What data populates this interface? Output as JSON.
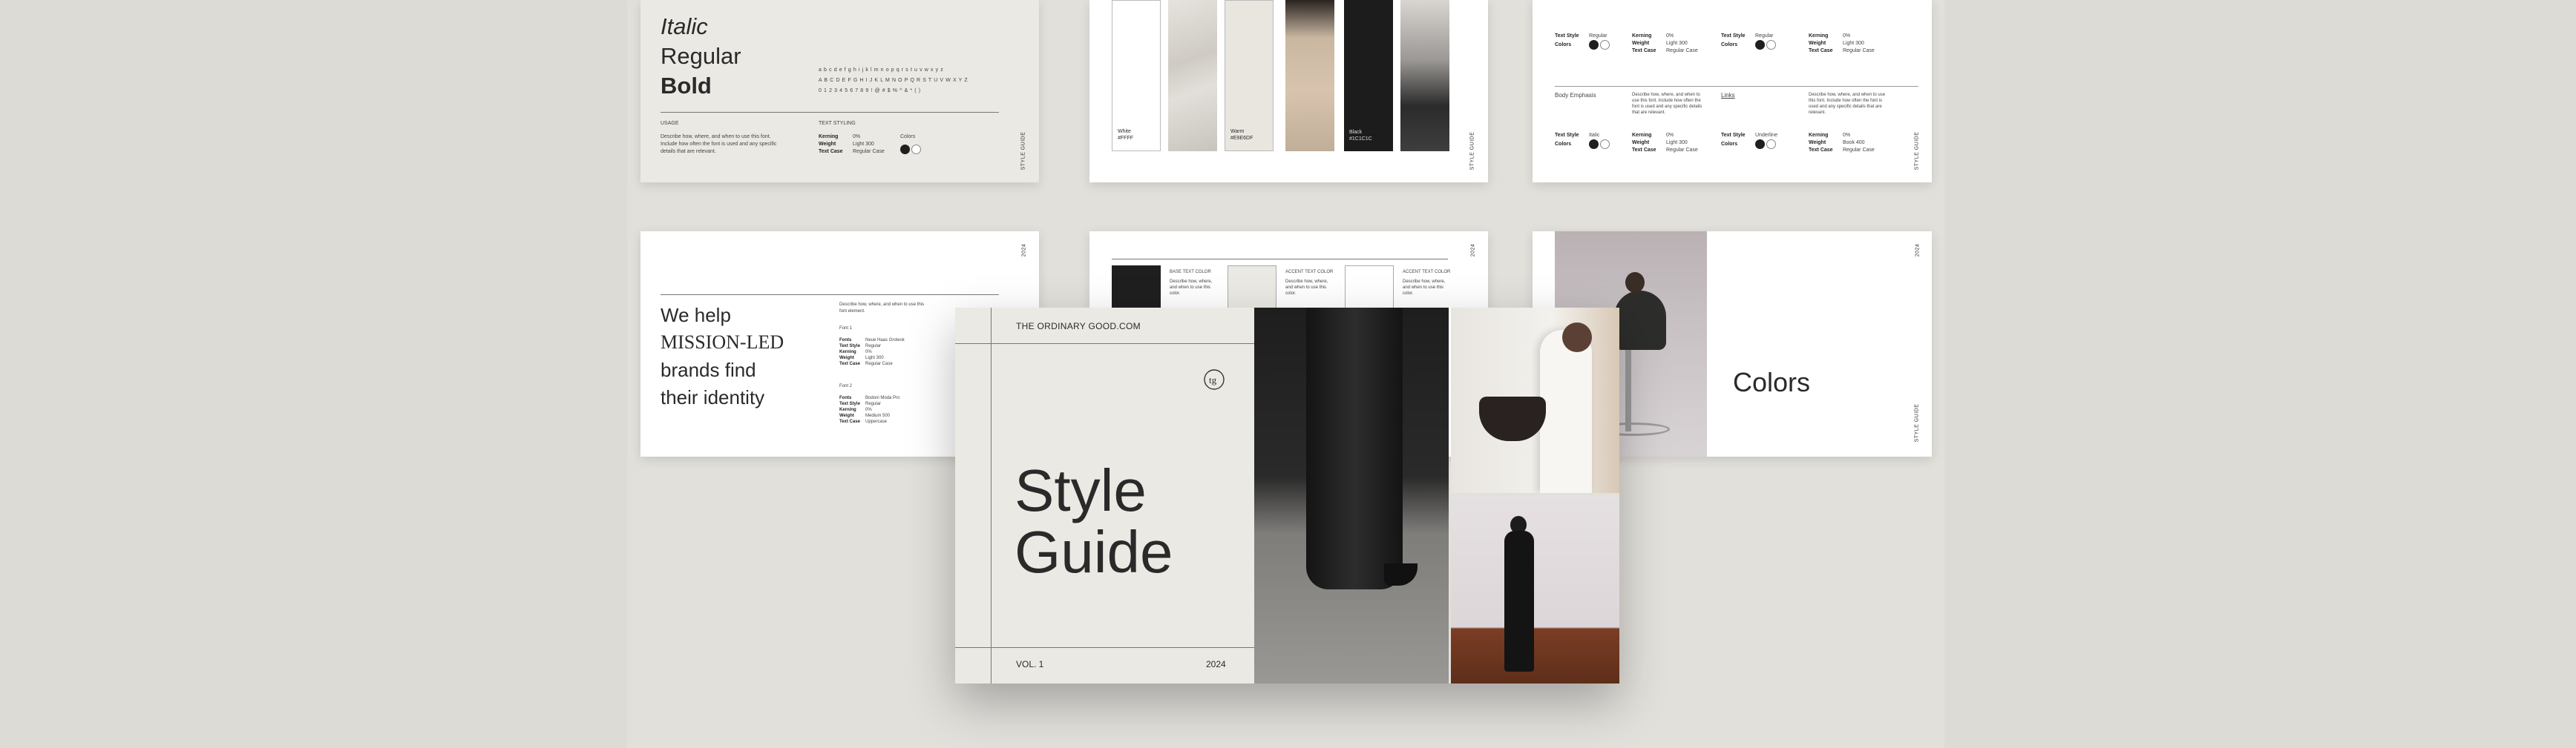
{
  "brand": "THE ORDINARY GOOD.COM",
  "cover": {
    "title_line1": "Style",
    "title_line2": "Guide",
    "vol": "VOL. 1",
    "year": "2024"
  },
  "side_label": "STYLE GUIDE",
  "corner_num": "2024",
  "typo_slide": {
    "italic": "Italic",
    "regular": "Regular",
    "bold": "Bold",
    "lower": "a b c d e f g h i j k l m n o p q r s t u v w x y z",
    "upper": "A B C D E F G H I J K L M N O P Q R S T U V W X Y Z",
    "nums": "0 1 2 3 4 5 6 7 8 9   ! @ # $ % ^ & * ( )",
    "usage_h": "USAGE",
    "usage_body": "Describe how, where, and when to use this font. Include how often the font is used and any specific details that are relevant.",
    "text_h": "TEXT STYLING",
    "rows": [
      {
        "k": "Kerning",
        "v": "0%"
      },
      {
        "k": "Weight",
        "v": "Light 300"
      },
      {
        "k": "Text Case",
        "v": "Regular Case"
      }
    ],
    "colors_h": "Colors"
  },
  "swatches": [
    {
      "l1": "White",
      "l2": "#FFFF"
    },
    {
      "l1": "",
      "l2": ""
    },
    {
      "l1": "Warm",
      "l2": "#E9E6DF"
    },
    {
      "l1": "",
      "l2": ""
    },
    {
      "l1": "Black",
      "l2": "#1C1C1C"
    },
    {
      "l1": "",
      "l2": ""
    }
  ],
  "mission": {
    "l1": "We help",
    "l2": "MISSION-LED",
    "l3": "brands find",
    "l4": "their identity",
    "intro": "Describe how, where, and when to use this font element.",
    "g1_h": "Font 1",
    "g1": [
      {
        "k": "Fonts",
        "v": "Neue Haas Grotesk"
      },
      {
        "k": "Text Style",
        "v": "Regular"
      },
      {
        "k": "Kerning",
        "v": "0%"
      },
      {
        "k": "Weight",
        "v": "Light 300"
      },
      {
        "k": "Text Case",
        "v": "Regular Case"
      }
    ],
    "g2_h": "Font 2",
    "g2": [
      {
        "k": "Fonts",
        "v": "Bodoni Moda Pro"
      },
      {
        "k": "Text Style",
        "v": "Regular"
      },
      {
        "k": "Kerning",
        "v": "0%"
      },
      {
        "k": "Weight",
        "v": "Medium 500"
      },
      {
        "k": "Text Case",
        "v": "Uppercase"
      }
    ]
  },
  "accent": {
    "items": [
      {
        "h": "BASE TEXT COLOR",
        "b": "Describe how, where, and when to use this color."
      },
      {
        "h": "ACCENT TEXT COLOR",
        "b": "Describe how, where, and when to use this color."
      },
      {
        "h": "ACCENT TEXT COLOR",
        "b": "Describe how, where, and when to use this color."
      }
    ]
  },
  "textstyle": {
    "top": [
      {
        "k": "Text Style",
        "v": "Regular"
      },
      {
        "k": "Colors",
        "v": ""
      }
    ],
    "mid": [
      {
        "k": "Kerning",
        "v": "0%"
      },
      {
        "k": "Weight",
        "v": "Light 300"
      },
      {
        "k": "Text Case",
        "v": "Regular Case"
      }
    ],
    "body_emph": "Body Emphasis",
    "links": "Links",
    "desc": "Describe how, where, and when to use this font. Include how often the font is used and any specific details that are relevant.",
    "bot1": [
      {
        "k": "Text Style",
        "v": "Italic"
      },
      {
        "k": "Colors",
        "v": ""
      }
    ],
    "bot2": [
      {
        "k": "Text Style",
        "v": "Underline"
      },
      {
        "k": "Colors",
        "v": ""
      }
    ],
    "bot3": [
      {
        "k": "Kerning",
        "v": "0%"
      },
      {
        "k": "Weight",
        "v": "Book 400"
      },
      {
        "k": "Text Case",
        "v": "Regular Case"
      }
    ]
  },
  "colors_slide": {
    "title": "Colors"
  },
  "palette": {
    "black": "#1f1f1f",
    "warm": "#ebe9e3",
    "white": "#ffffff"
  }
}
